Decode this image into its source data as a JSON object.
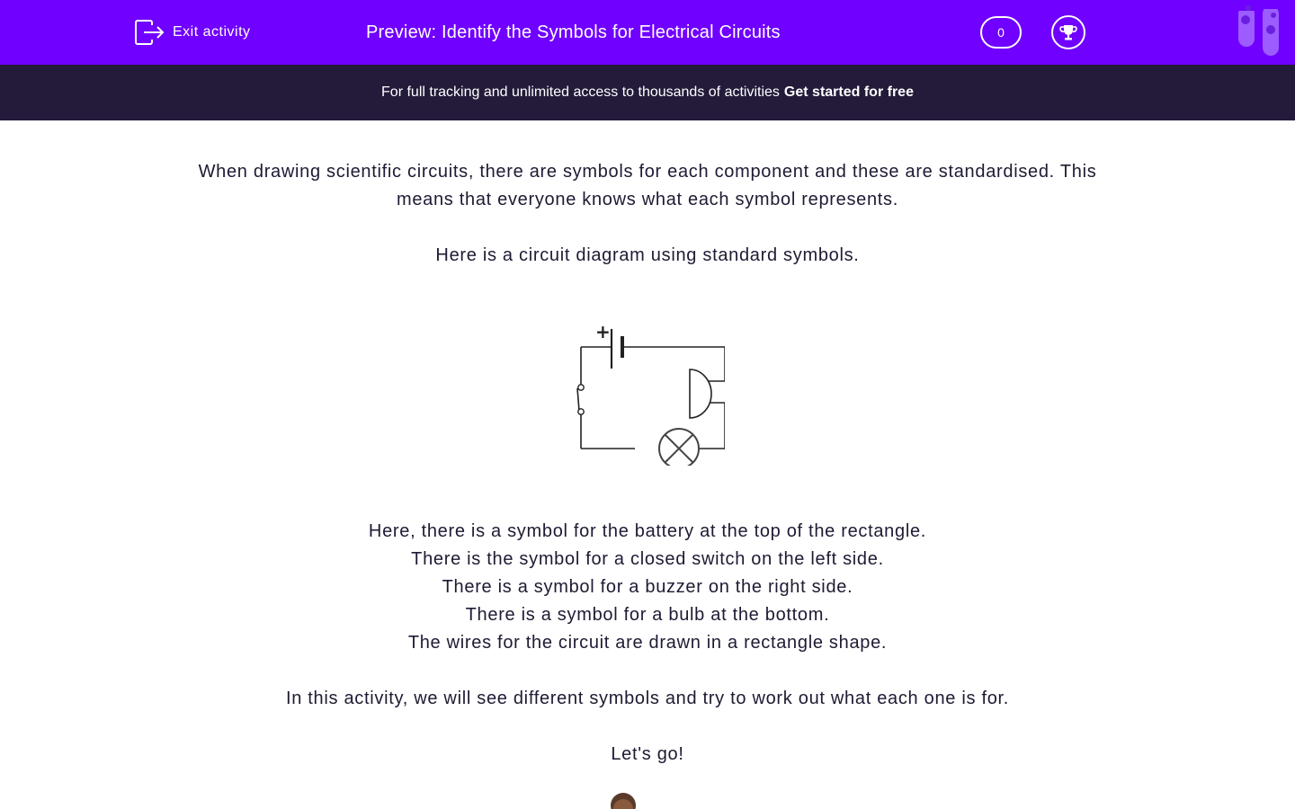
{
  "header": {
    "exit_label": "Exit activity",
    "title": "Preview: Identify the Symbols for Electrical Circuits",
    "score": "0",
    "bg_color": "#7000ff"
  },
  "banner": {
    "text": "For full tracking and unlimited access to thousands of activities",
    "cta": "Get started for free",
    "bg_color": "#241a3a"
  },
  "content": {
    "intro_line1": "When drawing scientific circuits, there are symbols for each component and these are standardised. This",
    "intro_line2": "means that everyone knows what each symbol represents.",
    "diagram_intro": "Here is a circuit diagram using standard symbols.",
    "explanations": [
      "Here, there is a symbol for the battery at the top of the rectangle.",
      "There is the symbol for a closed switch on the left side.",
      "There is a symbol for a buzzer on the right side.",
      "There is a symbol for a bulb at the bottom.",
      "The wires for the circuit are drawn in a rectangle shape."
    ],
    "activity_note": "In this activity, we will see different symbols and try to work out what each one is for.",
    "lets_go": "Let's go!"
  },
  "diagram": {
    "battery_sign": "+"
  }
}
